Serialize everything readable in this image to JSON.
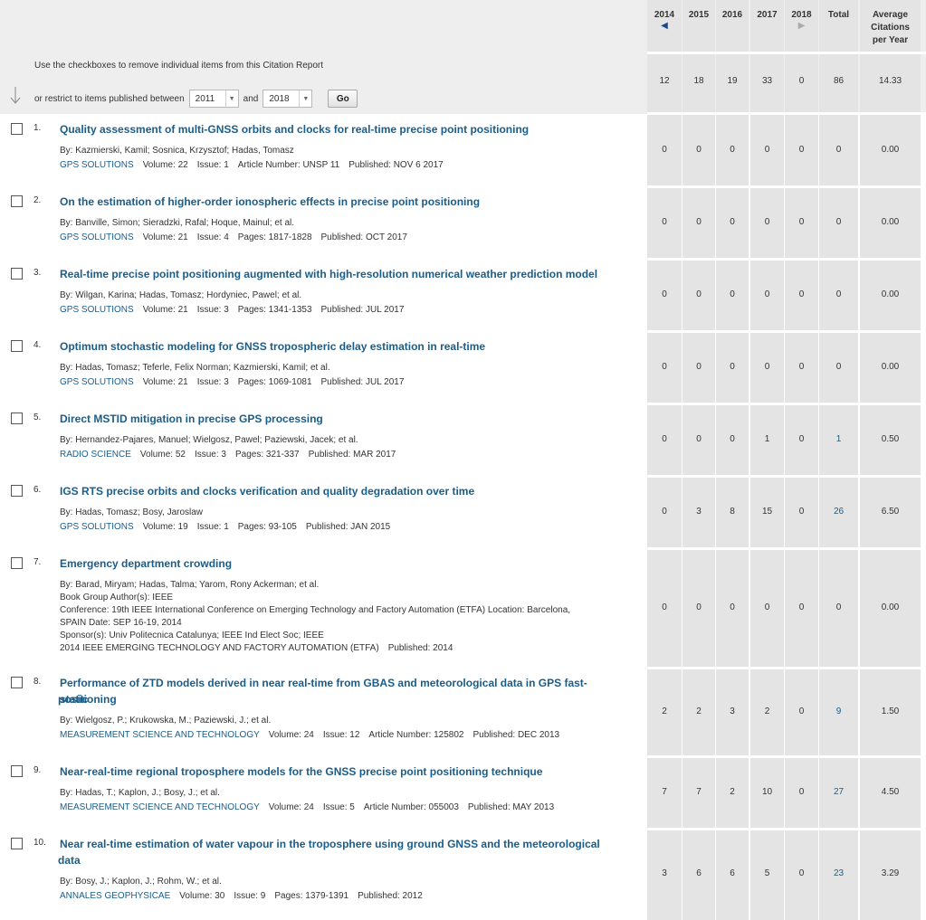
{
  "header": {
    "hint": "Use the checkboxes to remove individual items from this Citation Report",
    "restrict_label": "or restrict to items published between",
    "from_year": "2011",
    "and_label": "and",
    "to_year": "2018",
    "go_label": "Go"
  },
  "columns": {
    "y2014": "2014",
    "y2015": "2015",
    "y2016": "2016",
    "y2017": "2017",
    "y2018": "2018",
    "total": "Total",
    "avg_line1": "Average",
    "avg_line2": "Citations",
    "avg_line3": "per Year",
    "prev_icon": "triangle-left-icon",
    "next_icon": "triangle-right-icon"
  },
  "summary": {
    "y2014": "12",
    "y2015": "18",
    "y2016": "19",
    "y2017": "33",
    "y2018": "0",
    "total": "86",
    "avg": "14.33"
  },
  "records": [
    {
      "num": "1.",
      "title1": "Quality assessment of multi-GNSS orbits and clocks for real-time precise point positioning",
      "title2": "",
      "by": "By: Kazmierski, Kamil; Sosnica, Krzysztof; Hadas, Tomasz",
      "extra": [],
      "journal": "GPS SOLUTIONS",
      "volume": "Volume: 22",
      "issue": "Issue: 1",
      "pages": "Article Number: UNSP 11",
      "published": "Published: NOV 6 2017",
      "cites": {
        "y2014": "0",
        "y2015": "0",
        "y2016": "0",
        "y2017": "0",
        "y2018": "0",
        "total": "0",
        "avg": "0.00"
      }
    },
    {
      "num": "2.",
      "title1": "On the estimation of higher-order ionospheric effects in precise point positioning",
      "title2": "",
      "by": "By: Banville, Simon; Sieradzki, Rafal; Hoque, Mainul; et al.",
      "extra": [],
      "journal": "GPS SOLUTIONS",
      "volume": "Volume: 21",
      "issue": "Issue: 4",
      "pages": "Pages: 1817-1828",
      "published": "Published: OCT 2017",
      "cites": {
        "y2014": "0",
        "y2015": "0",
        "y2016": "0",
        "y2017": "0",
        "y2018": "0",
        "total": "0",
        "avg": "0.00"
      }
    },
    {
      "num": "3.",
      "title1": "Real-time precise point positioning augmented with high-resolution numerical weather prediction model",
      "title2": "",
      "by": "By: Wilgan, Karina; Hadas, Tomasz; Hordyniec, Pawel; et al.",
      "extra": [],
      "journal": "GPS SOLUTIONS",
      "volume": "Volume: 21",
      "issue": "Issue: 3",
      "pages": "Pages: 1341-1353",
      "published": "Published: JUL 2017",
      "cites": {
        "y2014": "0",
        "y2015": "0",
        "y2016": "0",
        "y2017": "0",
        "y2018": "0",
        "total": "0",
        "avg": "0.00"
      }
    },
    {
      "num": "4.",
      "title1": "Optimum stochastic modeling for GNSS tropospheric delay estimation in real-time",
      "title2": "",
      "by": "By: Hadas, Tomasz; Teferle, Felix Norman; Kazmierski, Kamil; et al.",
      "extra": [],
      "journal": "GPS SOLUTIONS",
      "volume": "Volume: 21",
      "issue": "Issue: 3",
      "pages": "Pages: 1069-1081",
      "published": "Published: JUL 2017",
      "cites": {
        "y2014": "0",
        "y2015": "0",
        "y2016": "0",
        "y2017": "0",
        "y2018": "0",
        "total": "0",
        "avg": "0.00"
      }
    },
    {
      "num": "5.",
      "title1": "Direct MSTID mitigation in precise GPS processing",
      "title2": "",
      "by": "By: Hernandez-Pajares, Manuel; Wielgosz, Pawel; Paziewski, Jacek; et al.",
      "extra": [],
      "journal": "RADIO SCIENCE",
      "volume": "Volume: 52",
      "issue": "Issue: 3",
      "pages": "Pages: 321-337",
      "published": "Published: MAR 2017",
      "cites": {
        "y2014": "0",
        "y2015": "0",
        "y2016": "0",
        "y2017": "1",
        "y2018": "0",
        "total": "1",
        "avg": "0.50"
      }
    },
    {
      "num": "6.",
      "title1": "IGS RTS precise orbits and clocks verification and quality degradation over time",
      "title2": "",
      "by": "By: Hadas, Tomasz; Bosy, Jaroslaw",
      "extra": [],
      "journal": "GPS SOLUTIONS",
      "volume": "Volume: 19",
      "issue": "Issue: 1",
      "pages": "Pages: 93-105",
      "published": "Published: JAN 2015",
      "cites": {
        "y2014": "0",
        "y2015": "3",
        "y2016": "8",
        "y2017": "15",
        "y2018": "0",
        "total": "26",
        "avg": "6.50"
      }
    },
    {
      "num": "7.",
      "title1": "Emergency department crowding",
      "title2": "",
      "by": "By: Barad, Miryam; Hadas, Talma; Yarom, Rony Ackerman; et al.",
      "extra": [
        "Book Group Author(s): IEEE",
        "Conference: 19th IEEE International Conference on Emerging Technology and Factory Automation (ETFA) Location: Barcelona,",
        "SPAIN Date: SEP 16-19, 2014",
        "Sponsor(s): Univ Politecnica Catalunya; IEEE Ind Elect Soc; IEEE"
      ],
      "journal_plain": "2014 IEEE EMERGING TECHNOLOGY AND FACTORY AUTOMATION (ETFA)",
      "published": "Published: 2014",
      "cites": {
        "y2014": "0",
        "y2015": "0",
        "y2016": "0",
        "y2017": "0",
        "y2018": "0",
        "total": "0",
        "avg": "0.00"
      }
    },
    {
      "num": "8.",
      "title1": "Performance of ZTD models derived in near real-time from GBAS and meteorological data in GPS fast-static",
      "title2": "positioning",
      "by": "By: Wielgosz, P.; Krukowska, M.; Paziewski, J.; et al.",
      "extra": [],
      "journal": "MEASUREMENT SCIENCE AND TECHNOLOGY",
      "volume": "Volume: 24",
      "issue": "Issue: 12",
      "pages": "Article Number: 125802",
      "published": "Published: DEC 2013",
      "cites": {
        "y2014": "2",
        "y2015": "2",
        "y2016": "3",
        "y2017": "2",
        "y2018": "0",
        "total": "9",
        "avg": "1.50"
      }
    },
    {
      "num": "9.",
      "title1": "Near-real-time regional troposphere models for the GNSS precise point positioning technique",
      "title2": "",
      "by": "By: Hadas, T.; Kaplon, J.; Bosy, J.; et al.",
      "extra": [],
      "journal": "MEASUREMENT SCIENCE AND TECHNOLOGY",
      "volume": "Volume: 24",
      "issue": "Issue: 5",
      "pages": "Article Number: 055003",
      "published": "Published: MAY 2013",
      "cites": {
        "y2014": "7",
        "y2015": "7",
        "y2016": "2",
        "y2017": "10",
        "y2018": "0",
        "total": "27",
        "avg": "4.50"
      }
    },
    {
      "num": "10.",
      "title1": "Near real-time estimation of water vapour in the troposphere using ground GNSS and the meteorological",
      "title2": "data",
      "by": "By: Bosy, J.; Kaplon, J.; Rohm, W.; et al.",
      "extra": [],
      "journal": "ANNALES GEOPHYSICAE",
      "volume": "Volume: 30",
      "issue": "Issue: 9",
      "pages": "Pages: 1379-1391",
      "published": "Published: 2012",
      "cites": {
        "y2014": "3",
        "y2015": "6",
        "y2016": "6",
        "y2017": "5",
        "y2018": "0",
        "total": "23",
        "avg": "3.29"
      }
    }
  ]
}
